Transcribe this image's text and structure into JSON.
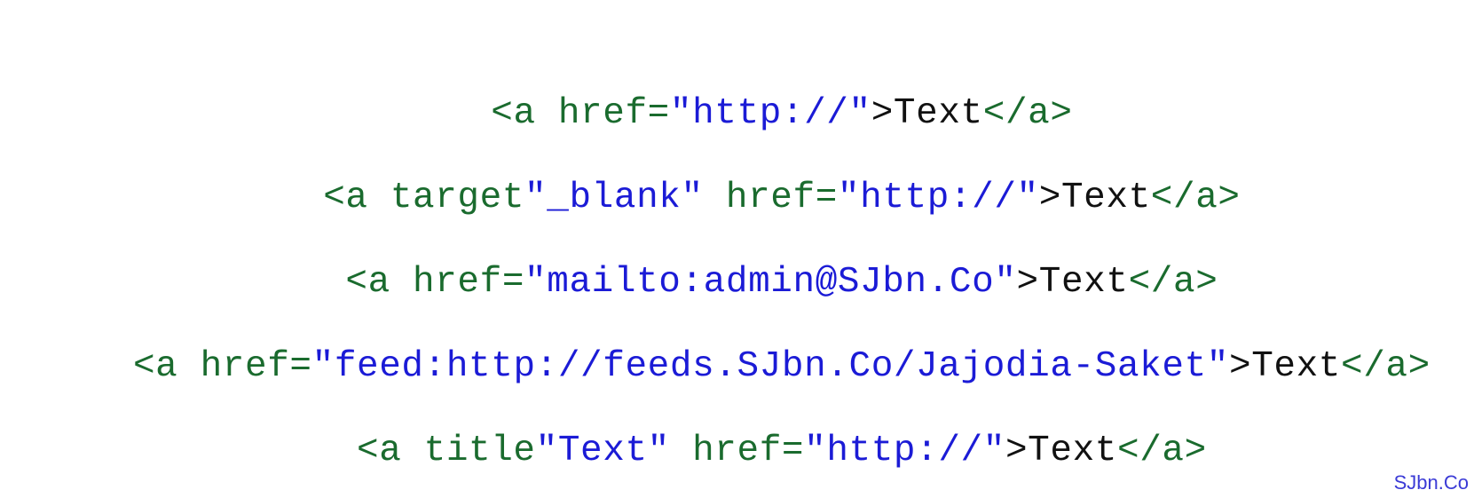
{
  "colors": {
    "tag": "#1a6b2e",
    "value": "#1b1bd6",
    "text": "#111111",
    "watermark": "#3b3bd6"
  },
  "lines": [
    {
      "segments": [
        {
          "type": "tag",
          "text": "<a href="
        },
        {
          "type": "val",
          "text": "\"http://\""
        },
        {
          "type": "text",
          "text": ">Text"
        },
        {
          "type": "tag",
          "text": "</a>"
        }
      ]
    },
    {
      "segments": [
        {
          "type": "tag",
          "text": "<a target"
        },
        {
          "type": "val",
          "text": "\"_blank\""
        },
        {
          "type": "tag",
          "text": " href="
        },
        {
          "type": "val",
          "text": "\"http://\""
        },
        {
          "type": "text",
          "text": ">Text"
        },
        {
          "type": "tag",
          "text": "</a>"
        }
      ]
    },
    {
      "segments": [
        {
          "type": "tag",
          "text": "<a href="
        },
        {
          "type": "val",
          "text": "\"mailto:admin@SJbn.Co\""
        },
        {
          "type": "text",
          "text": ">Text"
        },
        {
          "type": "tag",
          "text": "</a>"
        }
      ]
    },
    {
      "segments": [
        {
          "type": "tag",
          "text": "<a href="
        },
        {
          "type": "val",
          "text": "\"feed:http://feeds.SJbn.Co/Jajodia-Saket\""
        },
        {
          "type": "text",
          "text": ">Text"
        },
        {
          "type": "tag",
          "text": "</a>"
        }
      ]
    },
    {
      "segments": [
        {
          "type": "tag",
          "text": "<a title"
        },
        {
          "type": "val",
          "text": "\"Text\""
        },
        {
          "type": "tag",
          "text": " href="
        },
        {
          "type": "val",
          "text": "\"http://\""
        },
        {
          "type": "text",
          "text": ">Text"
        },
        {
          "type": "tag",
          "text": "</a>"
        }
      ]
    }
  ],
  "watermark": "SJbn.Co"
}
